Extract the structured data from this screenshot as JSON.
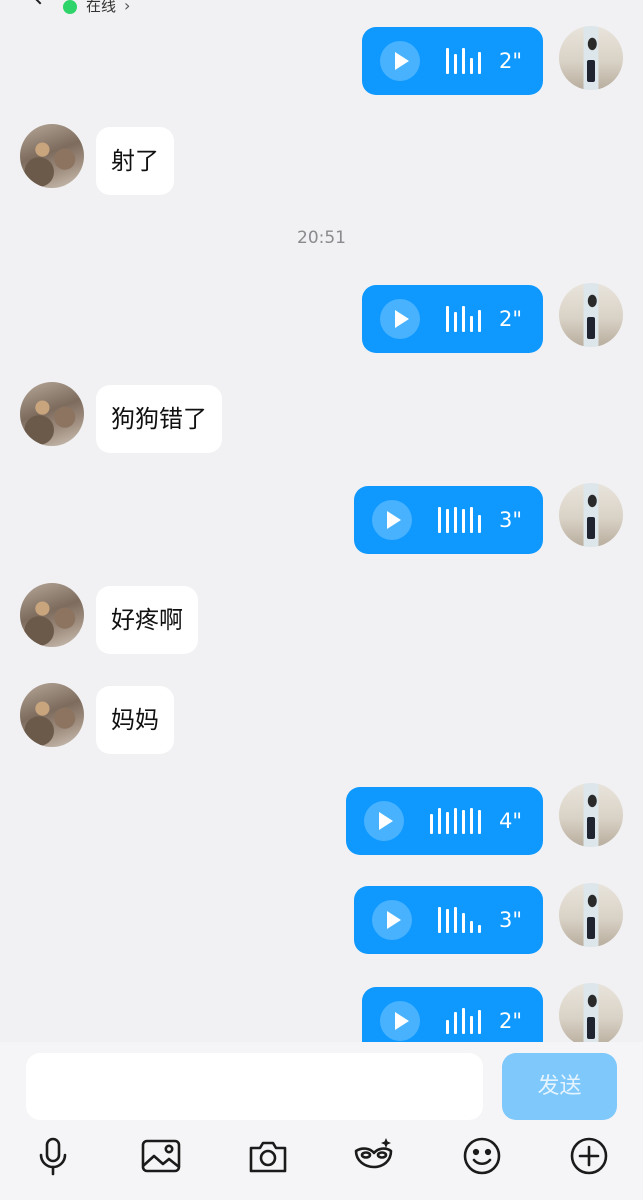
{
  "header": {
    "status_text": "在线",
    "arrow": "›"
  },
  "timestamp": "20:51",
  "messages": [
    {
      "type": "voice",
      "from": "me",
      "duration": "2\""
    },
    {
      "type": "text",
      "from": "them",
      "text": "射了"
    },
    {
      "type": "voice",
      "from": "me",
      "duration": "2\""
    },
    {
      "type": "text",
      "from": "them",
      "text": "狗狗错了"
    },
    {
      "type": "voice",
      "from": "me",
      "duration": "3\""
    },
    {
      "type": "text",
      "from": "them",
      "text": "好疼啊"
    },
    {
      "type": "text",
      "from": "them",
      "text": "妈妈"
    },
    {
      "type": "voice",
      "from": "me",
      "duration": "4\""
    },
    {
      "type": "voice",
      "from": "me",
      "duration": "3\""
    },
    {
      "type": "voice",
      "from": "me",
      "duration": "2\""
    }
  ],
  "composer": {
    "placeholder": "",
    "send_label": "发送"
  },
  "toolbar_icons": [
    "microphone-icon",
    "image-icon",
    "camera-icon",
    "eye-mask-sparkle-icon",
    "smiley-icon",
    "plus-circle-icon"
  ],
  "colors": {
    "voice_bubble": "#0f99ff",
    "send_disabled": "#7ec8fb",
    "online": "#2ed36a"
  }
}
